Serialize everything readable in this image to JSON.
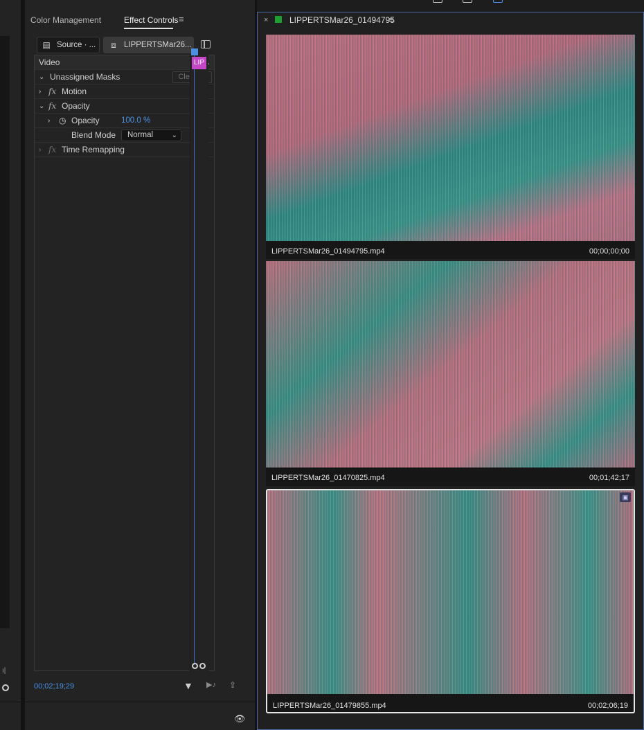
{
  "tabs": {
    "color_management": "Color Management",
    "effect_controls": "Effect Controls",
    "menu_glyph": "≡"
  },
  "header": {
    "source_label": "Source · ...",
    "clip_label": "LIPPERTSMar26..."
  },
  "effects": {
    "video_label": "Video",
    "unassigned_masks": "Unassigned Masks",
    "clear_all": "Clear all",
    "motion": "Motion",
    "opacity_group": "Opacity",
    "opacity_prop": "Opacity",
    "opacity_value": "100.0 %",
    "blend_mode_label": "Blend Mode",
    "blend_mode_value": "Normal",
    "time_remapping": "Time Remapping",
    "fx_glyph": "fx"
  },
  "timeline": {
    "clip_tag": "LIP",
    "timecode": "00;02;19;29"
  },
  "project": {
    "title": "LIPPERTSMar26_01494795",
    "close_glyph": "×",
    "menu_glyph": "≡",
    "color": "#1ea030",
    "clips": [
      {
        "name": "LIPPERTSMar26_01494795.mp4",
        "timecode": "00;00;00;00"
      },
      {
        "name": "LIPPERTSMar26_01470825.mp4",
        "timecode": "00;01;42;17"
      },
      {
        "name": "LIPPERTSMar26_01479855.mp4",
        "timecode": "00;02;06;19"
      }
    ]
  },
  "colors": {
    "accent_blue": "#4a93e8",
    "clip_magenta": "#c447c7",
    "panel_bg": "#232323"
  }
}
